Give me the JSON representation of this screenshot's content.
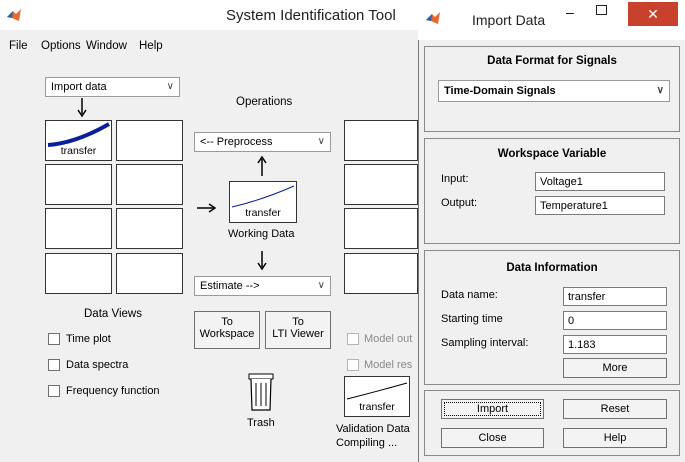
{
  "main": {
    "title": "System Identification Tool",
    "menu": [
      "File",
      "Options",
      "Window",
      "Help"
    ],
    "import_select": "Import data",
    "operations_label": "Operations",
    "preprocess_select": "<-- Preprocess",
    "working_data_name": "transfer",
    "working_data_label": "Working Data",
    "estimate_select": "Estimate -->",
    "to_workspace": [
      "To",
      "Workspace"
    ],
    "to_lti": [
      "To",
      "LTI Viewer"
    ],
    "data_views_label": "Data Views",
    "data_cell_name": "transfer",
    "checkboxes": [
      "Time plot",
      "Data spectra",
      "Frequency function"
    ],
    "model_checkboxes": [
      "Model out",
      "Model res"
    ],
    "trash_label": "Trash",
    "validation_data_name": "transfer",
    "validation_data_label": "Validation Data",
    "status": "Compiling ..."
  },
  "dialog": {
    "title": "Import Data",
    "format_title": "Data Format for Signals",
    "format_value": "Time-Domain Signals",
    "workspace_title": "Workspace Variable",
    "input_label": "Input:",
    "input_value": "Voltage1",
    "output_label": "Output:",
    "output_value": "Temperature1",
    "info_title": "Data Information",
    "name_label": "Data name:",
    "name_value": "transfer",
    "start_label": "Starting time",
    "start_value": "0",
    "interval_label": "Sampling interval:",
    "interval_value": "1.183",
    "more": "More",
    "import": "Import",
    "reset": "Reset",
    "close": "Close",
    "help": "Help"
  },
  "colors": {
    "plot_line": "#0a1f9c",
    "close_button": "#c8412d"
  },
  "icons": {
    "app": "matlab-icon",
    "dialog": "matlab-icon",
    "minimize": "minimize-icon",
    "maximize": "maximize-icon",
    "close": "close-icon",
    "arrow_right": "arrow-right-icon",
    "arrow_up": "arrow-up-icon",
    "arrow_down": "arrow-down-icon",
    "trash": "trash-icon"
  }
}
